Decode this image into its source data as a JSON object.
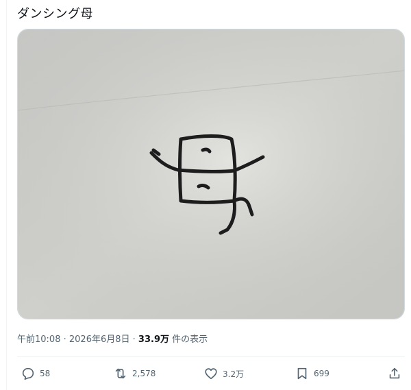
{
  "tweet": {
    "text": "ダンシング母"
  },
  "photo": {
    "drawn_character": "母"
  },
  "meta": {
    "time": "午前10:08",
    "separator1": " · ",
    "date": "2026年6月8日",
    "separator2": " · ",
    "views_count": "33.9万",
    "views_label": " 件の表示"
  },
  "actions": {
    "replies": "58",
    "reposts": "2,578",
    "likes": "3.2万",
    "bookmarks": "699"
  },
  "icons": [
    "reply-icon",
    "repost-icon",
    "like-icon",
    "bookmark-icon",
    "share-icon"
  ]
}
